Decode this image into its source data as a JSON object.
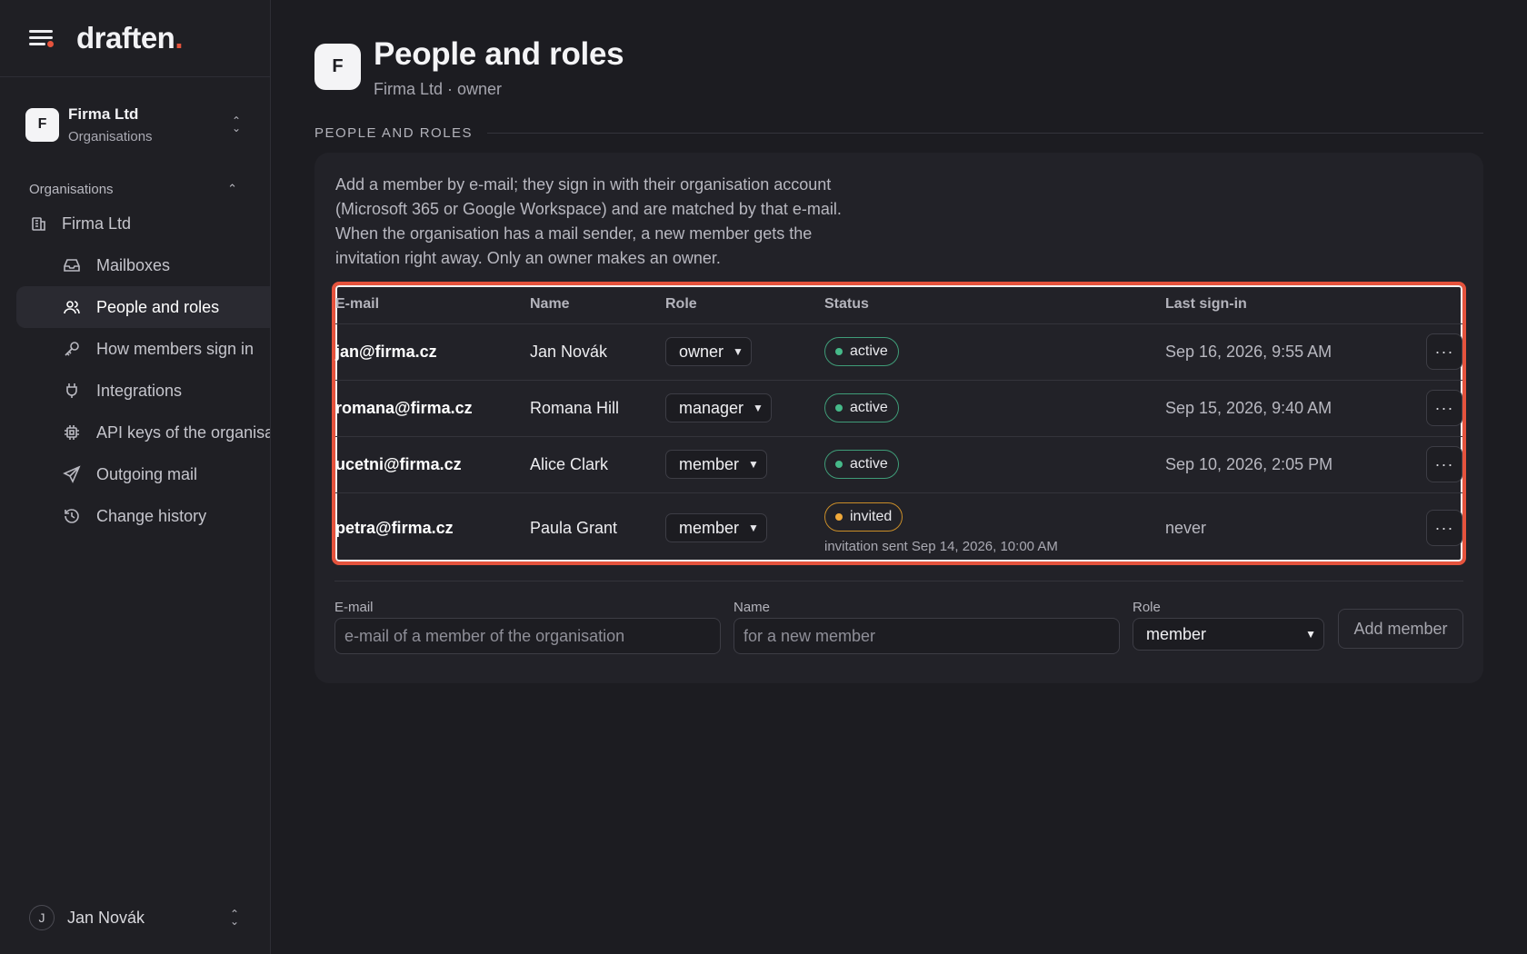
{
  "app": {
    "logo_text": "draften",
    "logo_dot": ".",
    "accent": "#e5533d"
  },
  "org_switcher": {
    "initial": "F",
    "name": "Firma Ltd",
    "subtitle": "Organisations"
  },
  "sidebar": {
    "section_label": "Organisations",
    "org_item": "Firma Ltd",
    "items": [
      {
        "label": "Mailboxes",
        "icon": "inbox-icon",
        "active": false
      },
      {
        "label": "People and roles",
        "icon": "users-icon",
        "active": true
      },
      {
        "label": "How members sign in",
        "icon": "key-icon",
        "active": false
      },
      {
        "label": "Integrations",
        "icon": "plug-icon",
        "active": false
      },
      {
        "label": "API keys of the organisation",
        "icon": "chip-icon",
        "active": false
      },
      {
        "label": "Outgoing mail",
        "icon": "send-icon",
        "active": false
      },
      {
        "label": "Change history",
        "icon": "history-icon",
        "active": false
      }
    ],
    "user": {
      "initial": "J",
      "name": "Jan Novák"
    }
  },
  "page": {
    "avatar": "F",
    "title": "People and roles",
    "subtitle": "Firma Ltd · owner",
    "section_label": "PEOPLE AND ROLES",
    "intro": "Add a member by e-mail; they sign in with their organisation account (Microsoft 365 or Google Workspace) and are matched by that e-mail. When the organisation has a mail sender, a new member gets the invitation right away. Only an owner makes an owner."
  },
  "table": {
    "headers": {
      "email": "E-mail",
      "name": "Name",
      "role": "Role",
      "status": "Status",
      "last": "Last sign-in"
    },
    "rows": [
      {
        "email": "jan@firma.cz",
        "name": "Jan Novák",
        "role": "owner",
        "status": "active",
        "last": "Sep 16, 2026, 9:55 AM",
        "note": ""
      },
      {
        "email": "romana@firma.cz",
        "name": "Romana Hill",
        "role": "manager",
        "status": "active",
        "last": "Sep 15, 2026, 9:40 AM",
        "note": ""
      },
      {
        "email": "ucetni@firma.cz",
        "name": "Alice Clark",
        "role": "member",
        "status": "active",
        "last": "Sep 10, 2026, 2:05 PM",
        "note": ""
      },
      {
        "email": "petra@firma.cz",
        "name": "Paula Grant",
        "role": "member",
        "status": "invited",
        "last": "never",
        "note": "invitation sent Sep 14, 2026, 10:00 AM"
      }
    ]
  },
  "form": {
    "email_label": "E-mail",
    "email_placeholder": "e-mail of a member of the organisation",
    "name_label": "Name",
    "name_placeholder": "for a new member",
    "role_label": "Role",
    "role_value": "member",
    "submit": "Add member"
  }
}
